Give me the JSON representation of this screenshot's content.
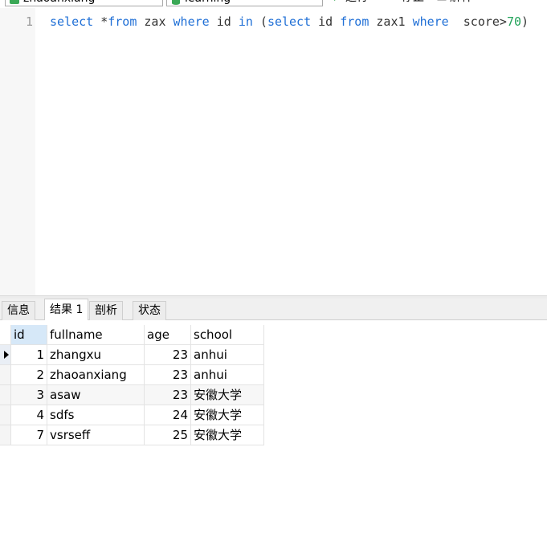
{
  "toolbar": {
    "connection_label": "zhaoanxiang",
    "database_label": "learning",
    "run_label": "运行",
    "stop_label": "停止",
    "explain_label": "解释"
  },
  "editor": {
    "line_number": "1",
    "tokens": {
      "t1": "select",
      "t2": " *",
      "t3": "from",
      "t4": " zax ",
      "t5": "where",
      "t6": " id ",
      "t7": "in",
      "t8": " (",
      "t9": "select",
      "t10": " id ",
      "t11": "from",
      "t12": " zax1 ",
      "t13": "where",
      "t14": "  score>",
      "t15": "70",
      "t16": ")"
    }
  },
  "tabs": [
    "信息",
    "结果 1",
    "剖析",
    "状态"
  ],
  "active_tab": "结果 1",
  "grid": {
    "columns": [
      "id",
      "fullname",
      "age",
      "school"
    ],
    "rows": [
      [
        "1",
        "zhangxu",
        "23",
        "anhui"
      ],
      [
        "2",
        "zhaoanxiang",
        "23",
        "anhui"
      ],
      [
        "3",
        "asaw",
        "23",
        "安徽大学"
      ],
      [
        "4",
        "sdfs",
        "24",
        "安徽大学"
      ],
      [
        "7",
        "vsrseff",
        "25",
        "安徽大学"
      ]
    ]
  },
  "colors": {
    "keyword": "#1f6fd6",
    "number": "#22a35a",
    "header_selected": "#d6e8f8"
  }
}
